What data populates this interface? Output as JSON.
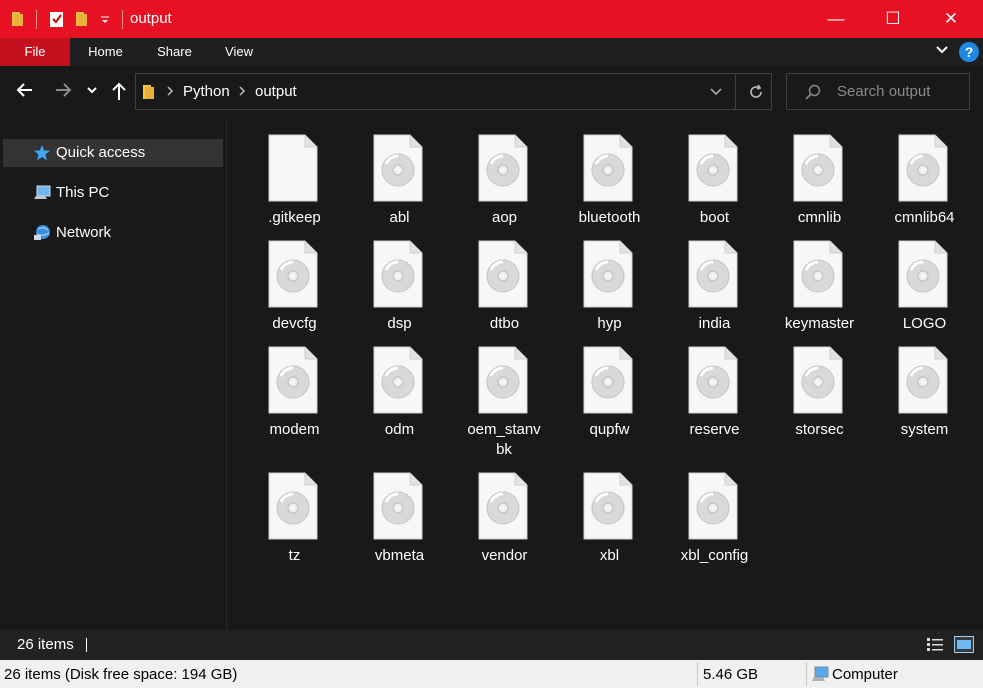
{
  "window": {
    "title": "output",
    "minimize_glyph": "—",
    "maximize_glyph": "☐",
    "close_glyph": "✕",
    "accent": "#e81123"
  },
  "ribbon": {
    "tabs": [
      "File",
      "Home",
      "Share",
      "View"
    ],
    "help_glyph": "?"
  },
  "address": {
    "breadcrumbs": [
      "Python",
      "output"
    ],
    "search_placeholder": "Search output"
  },
  "nav_pane": {
    "items": [
      {
        "label": "Quick access",
        "icon": "star-icon"
      },
      {
        "label": "This PC",
        "icon": "computer-icon"
      },
      {
        "label": "Network",
        "icon": "network-icon"
      }
    ]
  },
  "files": [
    {
      "name": ".gitkeep",
      "icon": "blank-file-icon"
    },
    {
      "name": "abl",
      "icon": "disc-image-file-icon"
    },
    {
      "name": "aop",
      "icon": "disc-image-file-icon"
    },
    {
      "name": "bluetooth",
      "icon": "disc-image-file-icon"
    },
    {
      "name": "boot",
      "icon": "disc-image-file-icon"
    },
    {
      "name": "cmnlib",
      "icon": "disc-image-file-icon"
    },
    {
      "name": "cmnlib64",
      "icon": "disc-image-file-icon"
    },
    {
      "name": "devcfg",
      "icon": "disc-image-file-icon"
    },
    {
      "name": "dsp",
      "icon": "disc-image-file-icon"
    },
    {
      "name": "dtbo",
      "icon": "disc-image-file-icon"
    },
    {
      "name": "hyp",
      "icon": "disc-image-file-icon"
    },
    {
      "name": "india",
      "icon": "disc-image-file-icon"
    },
    {
      "name": "keymaster",
      "icon": "disc-image-file-icon"
    },
    {
      "name": "LOGO",
      "icon": "disc-image-file-icon"
    },
    {
      "name": "modem",
      "icon": "disc-image-file-icon"
    },
    {
      "name": "odm",
      "icon": "disc-image-file-icon"
    },
    {
      "name": "oem_stanvbk",
      "icon": "disc-image-file-icon"
    },
    {
      "name": "qupfw",
      "icon": "disc-image-file-icon"
    },
    {
      "name": "reserve",
      "icon": "disc-image-file-icon"
    },
    {
      "name": "storsec",
      "icon": "disc-image-file-icon"
    },
    {
      "name": "system",
      "icon": "disc-image-file-icon"
    },
    {
      "name": "tz",
      "icon": "disc-image-file-icon"
    },
    {
      "name": "vbmeta",
      "icon": "disc-image-file-icon"
    },
    {
      "name": "vendor",
      "icon": "disc-image-file-icon"
    },
    {
      "name": "xbl",
      "icon": "disc-image-file-icon"
    },
    {
      "name": "xbl_config",
      "icon": "disc-image-file-icon"
    }
  ],
  "status": {
    "item_count": "26 items",
    "details": "26 items (Disk free space: 194 GB)",
    "size": "5.46 GB",
    "location": "Computer"
  }
}
